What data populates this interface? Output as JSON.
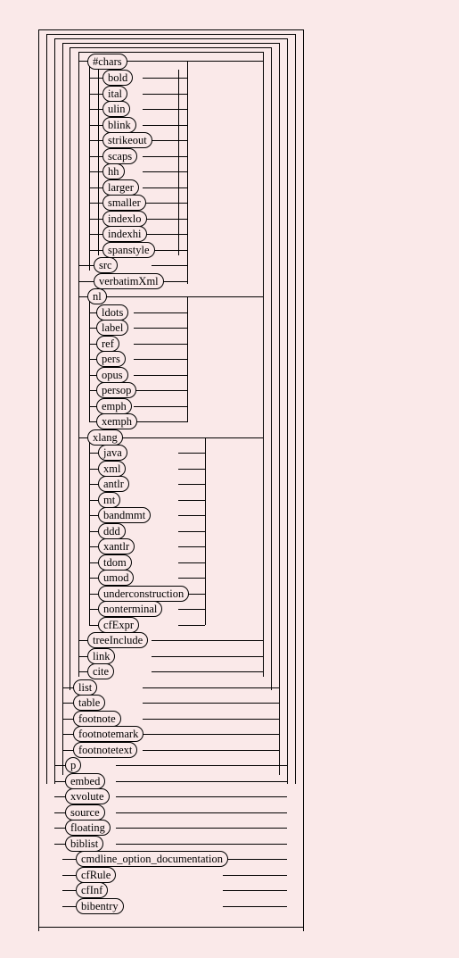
{
  "root": "#chars",
  "group1": [
    "bold",
    "ital",
    "ulin",
    "blink",
    "strikeout",
    "scaps",
    "hh",
    "larger",
    "smaller",
    "indexlo",
    "indexhi",
    "spanstyle"
  ],
  "group1b": [
    "src",
    "verbatimXml"
  ],
  "group2a": "nl",
  "group2": [
    "ldots",
    "label",
    "ref",
    "pers",
    "opus",
    "persop",
    "emph",
    "xemph"
  ],
  "xlang": "xlang",
  "group3": [
    "java",
    "xml",
    "antlr",
    "mt",
    "bandmmt",
    "ddd",
    "xantlr",
    "tdom",
    "umod",
    "underconstruction",
    "nonterminal",
    "cfExpr"
  ],
  "group3b": [
    "treeInclude",
    "link",
    "cite"
  ],
  "group4": [
    "list",
    "table",
    "footnote",
    "footnotemark",
    "footnotetext"
  ],
  "group5": [
    "p",
    "embed",
    "xvolute",
    "source",
    "floating",
    "biblist"
  ],
  "group6": [
    "cmdline_option_documentation",
    "cfRule",
    "cfInf",
    "bibentry"
  ]
}
